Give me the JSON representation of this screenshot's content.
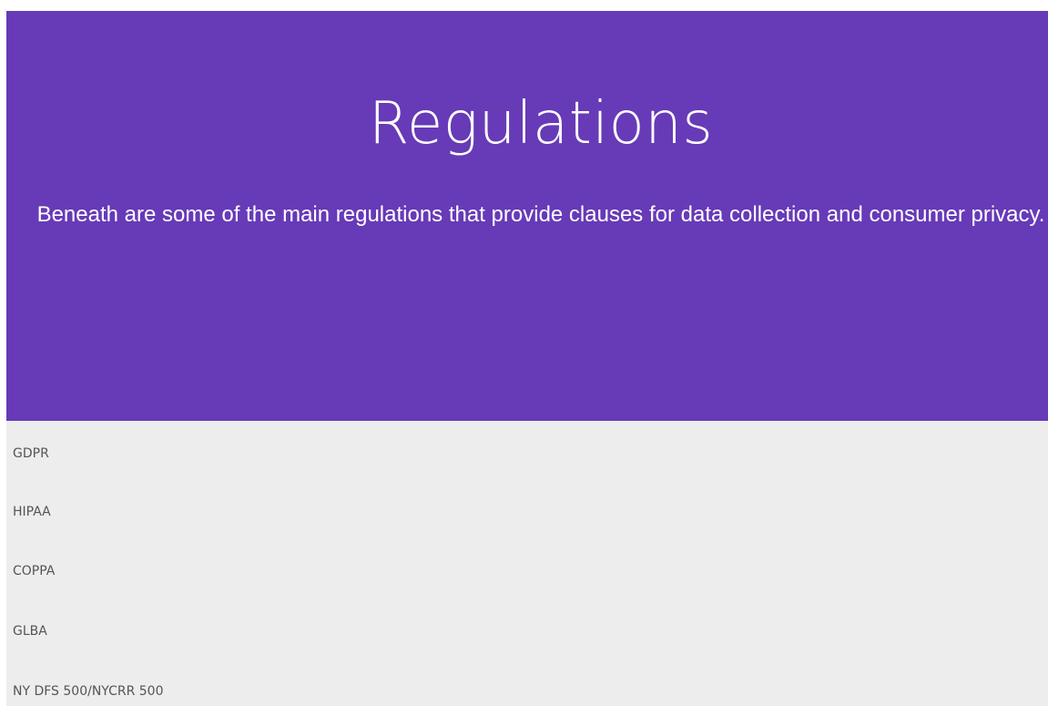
{
  "header": {
    "title": "Regulations",
    "subtitle": "Beneath are some of the main regulations that provide clauses for data collection and consumer privacy."
  },
  "regulations": [
    {
      "label": "GDPR"
    },
    {
      "label": "HIPAA"
    },
    {
      "label": "COPPA"
    },
    {
      "label": "GLBA"
    },
    {
      "label": "NY DFS 500/NYCRR 500"
    }
  ],
  "colors": {
    "hero_background": "#673ab7",
    "list_background": "#ededed",
    "list_text": "#555555"
  }
}
